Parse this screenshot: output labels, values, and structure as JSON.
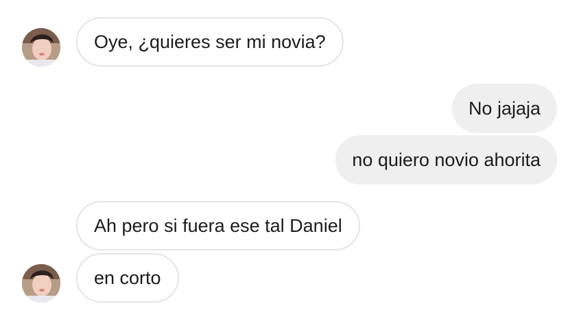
{
  "messages": [
    {
      "side": "incoming",
      "text": "Oye, ¿quieres ser mi novia?"
    },
    {
      "side": "outgoing",
      "text": "No jajaja"
    },
    {
      "side": "outgoing",
      "text": "no quiero novio ahorita"
    },
    {
      "side": "incoming",
      "text": "Ah pero si fuera ese tal Daniel"
    },
    {
      "side": "incoming",
      "text": "en corto"
    }
  ],
  "colors": {
    "incoming_bg": "#ffffff",
    "incoming_border": "#e4e4e4",
    "outgoing_bg": "#efefef",
    "text": "#1c1c1c"
  }
}
